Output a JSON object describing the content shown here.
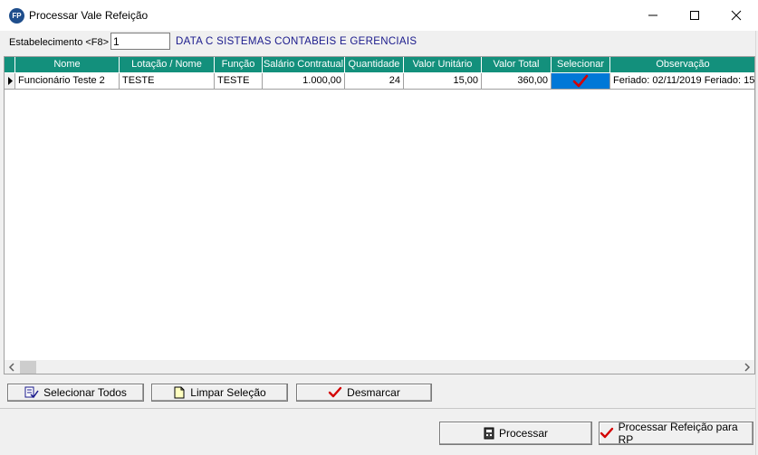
{
  "window": {
    "icon_text": "FP",
    "title": "Processar Vale Refeição"
  },
  "estabelecimento": {
    "label": "Estabelecimento <F8>",
    "value": "1",
    "name": "DATA C SISTEMAS CONTABEIS E GERENCIAIS"
  },
  "grid": {
    "columns": [
      "Nome",
      "Lotação / Nome",
      "Função",
      "Salário Contratual",
      "Quantidade",
      "Valor Unitário",
      "Valor Total",
      "Selecionar",
      "Observação"
    ],
    "rows": [
      {
        "nome": "Funcionário Teste 2",
        "lotacao": "TESTE",
        "funcao": "TESTE",
        "salario": "1.000,00",
        "quantidade": "24",
        "valor_unitario": "15,00",
        "valor_total": "360,00",
        "selecionado": true,
        "observacao": "Feriado: 02/11/2019 Feriado: 15/"
      }
    ]
  },
  "buttons": {
    "selecionar_todos": "Selecionar Todos",
    "limpar_selecao": "Limpar Seleção",
    "desmarcar": "Desmarcar",
    "processar": "Processar",
    "processar_rp": "Processar Refeição para RP"
  },
  "colors": {
    "header_bg": "#13907c",
    "selection_bg": "#0078d7",
    "check_red": "#d40000",
    "estab_name": "#1a1a8c"
  }
}
